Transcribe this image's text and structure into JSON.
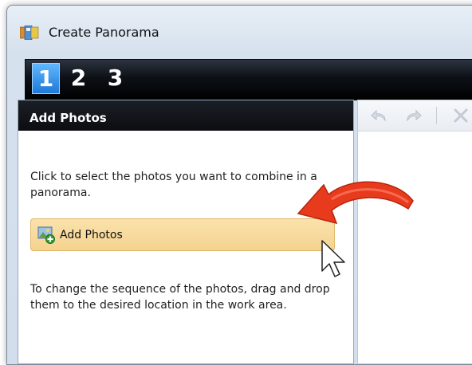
{
  "window": {
    "title": "Create Panorama"
  },
  "steps": [
    "1",
    "2",
    "3"
  ],
  "left_panel": {
    "header": "Add Photos",
    "description": "Click to select the photos you want to combine in a panorama.",
    "add_button_label": "Add Photos",
    "instructions": "To change the sequence of the photos, drag and drop them to the desired location in the work area."
  },
  "toolbar": {
    "icons": [
      "undo-icon",
      "redo-icon",
      "delete-icon"
    ]
  },
  "colors": {
    "add_button_bg": "#f7d99c",
    "active_step": "#2b8fe8",
    "arrow": "#e83b1e"
  }
}
